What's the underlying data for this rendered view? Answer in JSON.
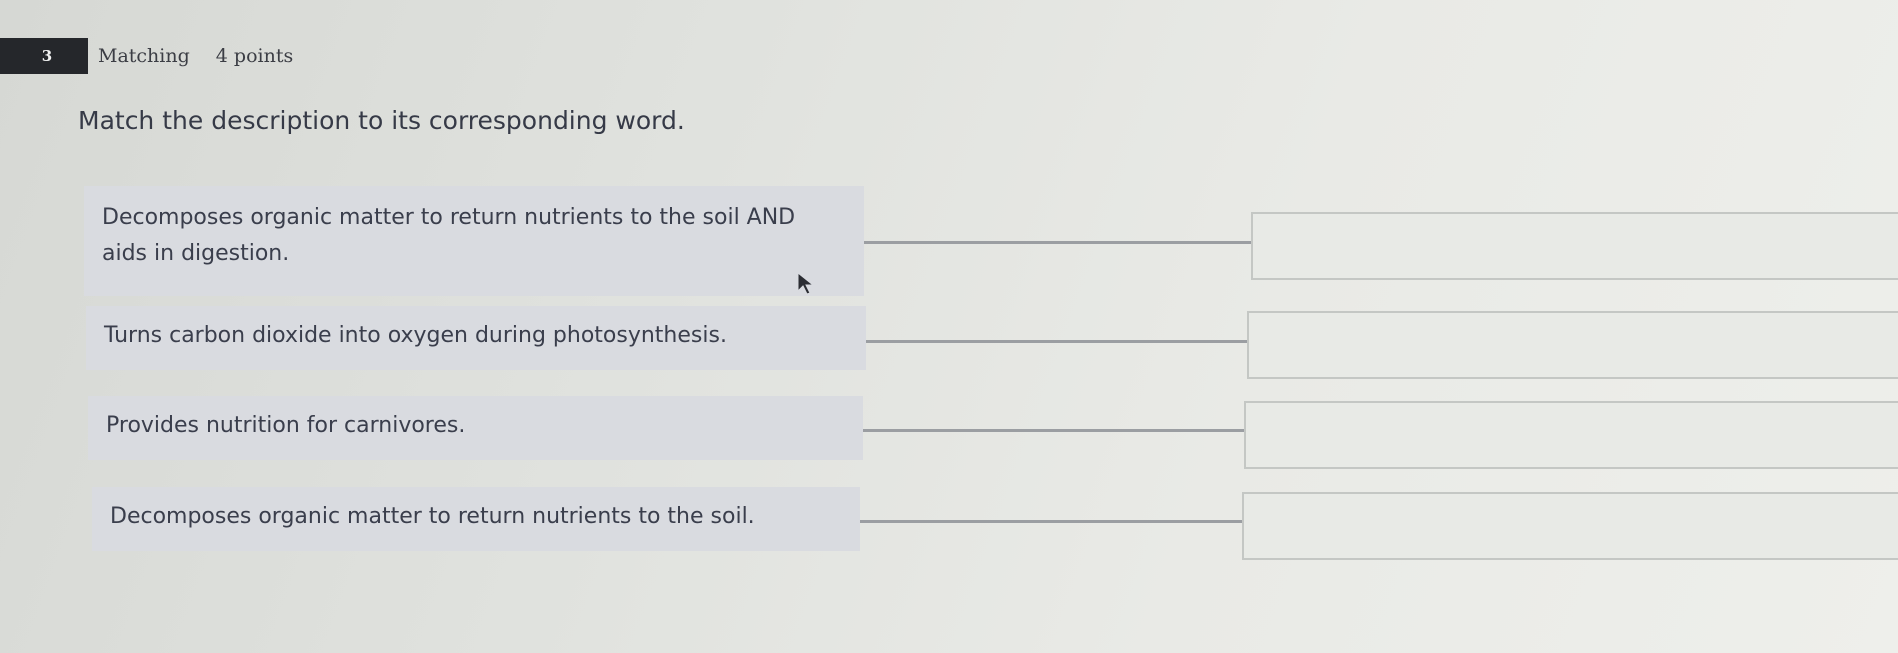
{
  "question": {
    "number": "3",
    "type": "Matching",
    "points": "4 points",
    "instruction": "Match the description to its corresponding word."
  },
  "prompts": [
    {
      "text": "Decomposes organic matter to return nutrients to the soil AND aids in digestion."
    },
    {
      "text": "Turns carbon dioxide into oxygen during photosynthesis."
    },
    {
      "text": "Provides nutrition for carnivores."
    },
    {
      "text": "Decomposes organic matter to return nutrients to the soil."
    }
  ],
  "answers": [
    "",
    "",
    "",
    ""
  ]
}
